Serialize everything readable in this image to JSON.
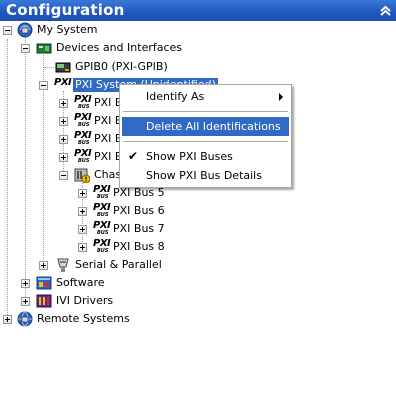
{
  "window": {
    "title": "Configuration"
  },
  "tree": {
    "my_system": "My System",
    "devices": "Devices and Interfaces",
    "gpib": "GPIB0 (PXI-GPIB)",
    "pxi_system": "PXI System (Unidentified)",
    "pxi_bus_1": "PXI B",
    "pxi_bus_2": "PXI B",
    "pxi_bus_3": "PXI B",
    "pxi_bus_4": "PXI B",
    "chassis": "Chas",
    "bus5": "PXI Bus 5",
    "bus6": "PXI Bus 6",
    "bus7": "PXI Bus 7",
    "bus8": "PXI Bus 8",
    "serial": "Serial & Parallel",
    "software": "Software",
    "ivi": "IVI Drivers",
    "remote": "Remote Systems",
    "pxi_icon_text": "PXI",
    "pxi_icon_sub": "BUS"
  },
  "context_menu": {
    "identify_as": "Identify As",
    "delete_all": "Delete All Identifications",
    "show_buses": "Show PXI Buses",
    "show_bus_details": "Show PXI Bus Details",
    "check_mark": "✔"
  },
  "colors": {
    "titlebar": "#2358c2",
    "selection": "#316ac5",
    "menu_border": "#aca899"
  }
}
